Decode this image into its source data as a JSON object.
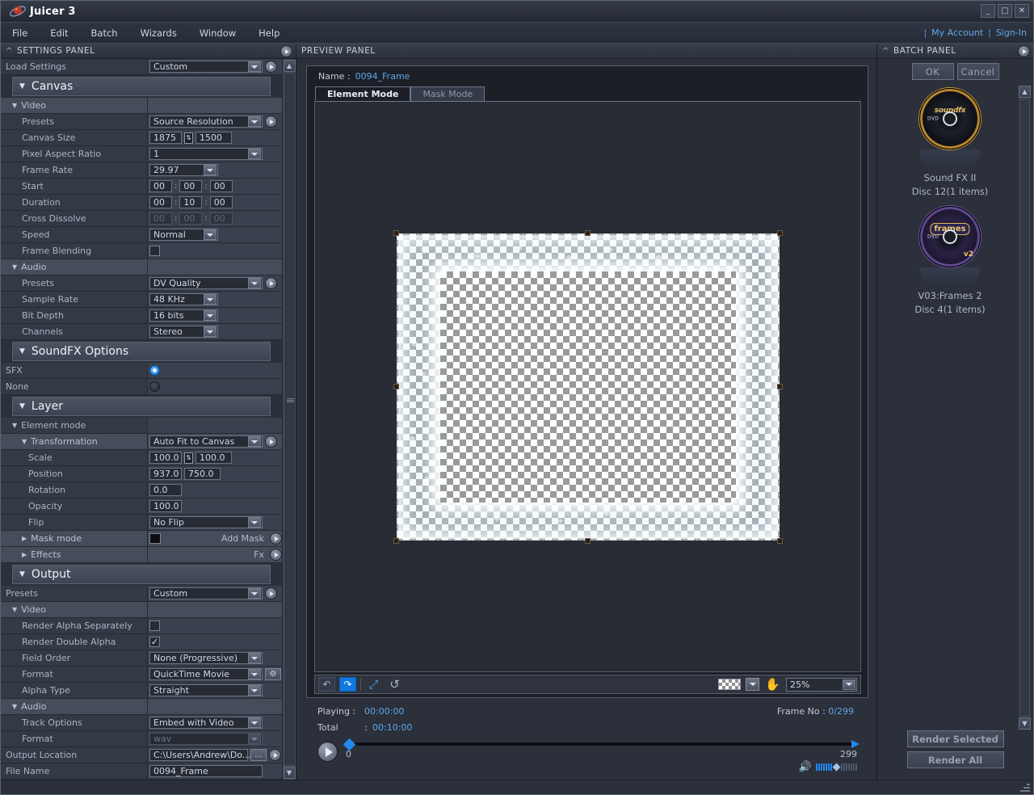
{
  "window": {
    "title": "Juicer 3",
    "minimize": "_",
    "maximize": "□",
    "close": "✕"
  },
  "menubar": {
    "items": [
      "File",
      "Edit",
      "Batch",
      "Wizards",
      "Window",
      "Help"
    ],
    "account": {
      "my_account": "My Account",
      "sign_in": "Sign-In",
      "separator": "|"
    }
  },
  "settings_panel": {
    "title": "SETTINGS PANEL",
    "load_settings": {
      "label": "Load Settings",
      "value": "Custom"
    },
    "canvas": {
      "section": "Canvas",
      "video_sub": "Video",
      "presets": {
        "label": "Presets",
        "value": "Source Resolution"
      },
      "canvas_size": {
        "label": "Canvas Size",
        "width": "1875",
        "height": "1500"
      },
      "pixel_aspect_ratio": {
        "label": "Pixel Aspect Ratio",
        "value": "1"
      },
      "frame_rate": {
        "label": "Frame Rate",
        "value": "29.97"
      },
      "start": {
        "label": "Start",
        "h": "00",
        "m": "00",
        "s": "00"
      },
      "duration": {
        "label": "Duration",
        "h": "00",
        "m": "10",
        "s": "00"
      },
      "cross_dissolve": {
        "label": "Cross Dissolve",
        "h": "00",
        "m": "00",
        "s": "00"
      },
      "speed": {
        "label": "Speed",
        "value": "Normal"
      },
      "frame_blending": {
        "label": "Frame Blending",
        "checked": ""
      },
      "audio_sub": "Audio",
      "audio_presets": {
        "label": "Presets",
        "value": "DV Quality"
      },
      "sample_rate": {
        "label": "Sample Rate",
        "value": "48 KHz"
      },
      "bit_depth": {
        "label": "Bit Depth",
        "value": "16 bits"
      },
      "channels": {
        "label": "Channels",
        "value": "Stereo"
      }
    },
    "soundfx": {
      "section": "SoundFX Options",
      "sfx": {
        "label": "SFX"
      },
      "none": {
        "label": "None"
      }
    },
    "layer": {
      "section": "Layer",
      "element_mode": "Element mode",
      "transformation": {
        "label": "Transformation",
        "value": "Auto Fit to Canvas"
      },
      "scale": {
        "label": "Scale",
        "x": "100.0",
        "y": "100.0"
      },
      "position": {
        "label": "Position",
        "x": "937.0",
        "y": "750.0"
      },
      "rotation": {
        "label": "Rotation",
        "value": "0.0"
      },
      "opacity": {
        "label": "Opacity",
        "value": "100.0"
      },
      "flip": {
        "label": "Flip",
        "value": "No Flip"
      },
      "mask_mode": {
        "label": "Mask mode",
        "action": "Add Mask"
      },
      "effects": {
        "label": "Effects",
        "action": "Fx"
      }
    },
    "output": {
      "section": "Output",
      "presets": {
        "label": "Presets",
        "value": "Custom"
      },
      "video_sub": "Video",
      "render_alpha_separately": {
        "label": "Render Alpha Separately",
        "checked": ""
      },
      "render_double_alpha": {
        "label": "Render Double Alpha",
        "checked": "✓"
      },
      "field_order": {
        "label": "Field Order",
        "value": "None (Progressive)"
      },
      "format": {
        "label": "Format",
        "value": "QuickTime Movie"
      },
      "alpha_type": {
        "label": "Alpha Type",
        "value": "Straight"
      },
      "audio_sub": "Audio",
      "track_options": {
        "label": "Track Options",
        "value": "Embed with Video"
      },
      "audio_format": {
        "label": "Format",
        "value": "wav"
      },
      "output_location": {
        "label": "Output Location",
        "value": "C:\\Users\\Andrew\\Do...",
        "browse": "..."
      },
      "file_name": {
        "label": "File Name",
        "value": "0094_Frame"
      }
    }
  },
  "preview_panel": {
    "title": "PREVIEW PANEL",
    "name_label": "Name :",
    "name_value": "0094_Frame",
    "tabs": [
      {
        "label": "Element Mode",
        "active": true
      },
      {
        "label": "Mask Mode",
        "active": false
      }
    ],
    "toolbar": {
      "undo": "↶",
      "redo": "↷",
      "fit": "⤢",
      "reset": "↺",
      "background_swatch": "checker-swatch",
      "hand": "✋",
      "zoom": "25%"
    },
    "playback": {
      "playing_label": "Playing :",
      "playing_value": "00:00:00",
      "total_label": "Total",
      "total_colon": ":",
      "total_value": "00:10:00",
      "frame_label": "Frame No :",
      "frame_value": "0/299",
      "timeline_start": "0",
      "timeline_end": "299"
    }
  },
  "batch_panel": {
    "title": "BATCH PANEL",
    "ok": "OK",
    "cancel": "Cancel",
    "items": [
      {
        "title": "Sound FX II",
        "subtitle": "Disc 12(1 items)",
        "disc_label": "soundfx II",
        "disc_kind": "d1"
      },
      {
        "title": "V03:Frames 2",
        "subtitle": "Disc 4(1 items)",
        "disc_label": "frames",
        "disc_kind": "d2"
      }
    ],
    "render_selected": "Render Selected",
    "render_all": "Render All"
  }
}
